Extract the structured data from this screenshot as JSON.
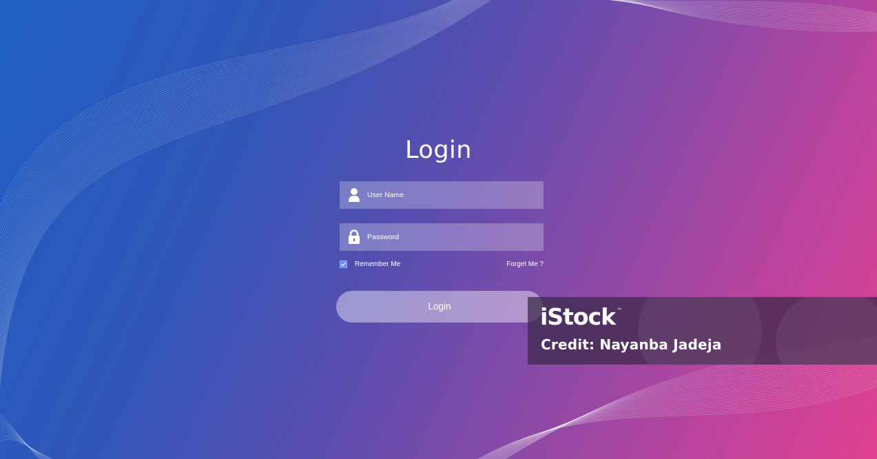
{
  "login_form": {
    "title": "Login",
    "username": {
      "placeholder": "User Name",
      "value": ""
    },
    "password": {
      "placeholder": "Password",
      "value": ""
    },
    "remember_me": {
      "label": "Remember Me",
      "checked": true
    },
    "forget_link": "Forget Me ?",
    "submit_label": "Login"
  },
  "icons": {
    "username_icon": "user-icon",
    "password_icon": "lock-icon",
    "checkbox_icon": "checkmark-icon"
  },
  "watermark": {
    "brand": "iStock",
    "trademark": "™",
    "credit": "Credit: Nayanba Jadeja"
  },
  "colors": {
    "gradient_start": "#1f5fc4",
    "gradient_mid": "#5a4eaf",
    "gradient_end": "#e0408e",
    "checkbox": "#5b8ee8"
  }
}
